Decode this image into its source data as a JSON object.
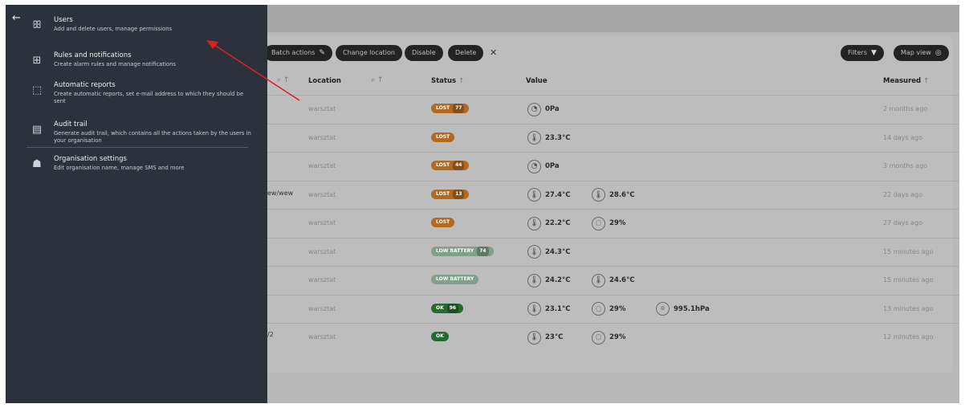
{
  "toolbar": {
    "batch_actions": "Batch actions",
    "change_location": "Change location",
    "disable": "Disable",
    "delete": "Delete",
    "filters": "Filters",
    "map_view": "Map view"
  },
  "table": {
    "headers": {
      "location": "Location",
      "status": "Status",
      "value": "Value",
      "measured": "Measured"
    },
    "partial_names": {
      "row4": "ew/wew",
      "row9": "/2"
    },
    "rows": [
      {
        "location": "warsztat",
        "status": "LOST",
        "status_count": "77",
        "status_type": "lost",
        "values": [
          {
            "icon": "gauge-icon",
            "text": "0Pa"
          }
        ],
        "measured": "2 months ago"
      },
      {
        "location": "warsztat",
        "status": "LOST",
        "status_count": "",
        "status_type": "lost",
        "values": [
          {
            "icon": "thermometer-icon",
            "text": "23.3°C"
          }
        ],
        "measured": "14 days ago"
      },
      {
        "location": "warsztat",
        "status": "LOST",
        "status_count": "44",
        "status_type": "lost",
        "values": [
          {
            "icon": "gauge-icon",
            "text": "0Pa"
          }
        ],
        "measured": "3 months ago"
      },
      {
        "location": "warsztat",
        "status": "LOST",
        "status_count": "13",
        "status_type": "lost",
        "values": [
          {
            "icon": "thermometer-icon",
            "text": "27.4°C"
          },
          {
            "icon": "thermometer-icon",
            "text": "28.6°C"
          }
        ],
        "measured": "22 days ago"
      },
      {
        "location": "warsztat",
        "status": "LOST",
        "status_count": "",
        "status_type": "lost",
        "values": [
          {
            "icon": "thermometer-icon",
            "text": "22.2°C"
          },
          {
            "icon": "humidity-icon",
            "text": "29%"
          }
        ],
        "measured": "27 days ago"
      },
      {
        "location": "warsztat",
        "status": "LOW BATTERY",
        "status_count": "74",
        "status_type": "low",
        "values": [
          {
            "icon": "thermometer-icon",
            "text": "24.3°C"
          }
        ],
        "measured": "15 minutes ago"
      },
      {
        "location": "warsztat",
        "status": "LOW BATTERY",
        "status_count": "",
        "status_type": "low",
        "values": [
          {
            "icon": "thermometer-icon",
            "text": "24.2°C"
          },
          {
            "icon": "thermometer-icon",
            "text": "24.6°C"
          }
        ],
        "measured": "15 minutes ago"
      },
      {
        "location": "warsztat",
        "status": "OK",
        "status_count": "96",
        "status_type": "ok",
        "values": [
          {
            "icon": "thermometer-icon",
            "text": "23.1°C"
          },
          {
            "icon": "humidity-icon",
            "text": "29%"
          },
          {
            "icon": "pressure-icon",
            "text": "995.1hPa"
          }
        ],
        "measured": "13 minutes ago"
      },
      {
        "location": "warsztat",
        "status": "OK",
        "status_count": "",
        "status_type": "ok",
        "values": [
          {
            "icon": "thermometer-icon",
            "text": "23°C"
          },
          {
            "icon": "humidity-icon",
            "text": "29%"
          }
        ],
        "measured": "12 minutes ago"
      }
    ]
  },
  "menu": {
    "items": [
      {
        "icon": "users-icon",
        "title": "Users",
        "description": "Add and delete users, manage permissions"
      },
      {
        "icon": "rules-icon",
        "title": "Rules and notifications",
        "description": "Create alarm rules and manage notifications"
      },
      {
        "icon": "report-icon",
        "title": "Automatic reports",
        "description": "Create automatic reports, set e-mail address to which they should be sent"
      },
      {
        "icon": "audit-icon",
        "title": "Audit trail",
        "description": "Generate audit trail, which contains all the actions taken by the users in your organisation"
      },
      {
        "icon": "organisation-icon",
        "title": "Organisation settings",
        "description": "Edit organisation name, manage SMS and more"
      }
    ]
  },
  "colors": {
    "sidebar": "#2c323b",
    "lost": "#b06a22",
    "low_battery": "#7fa08a",
    "ok": "#256b30",
    "arrow": "#e02020"
  }
}
